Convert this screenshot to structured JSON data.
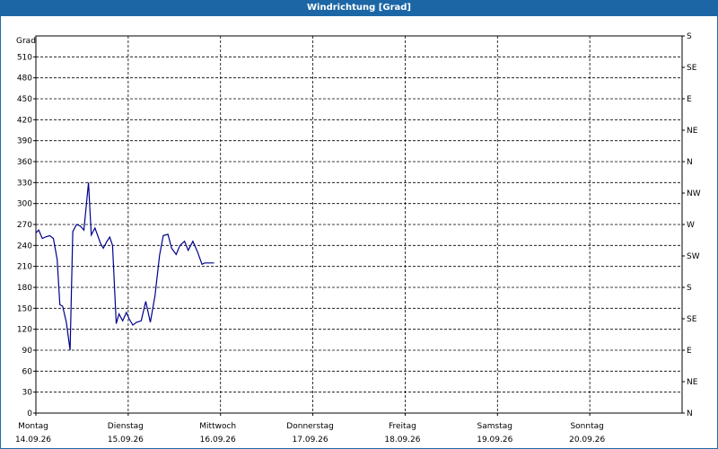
{
  "window": {
    "title": "Windrichtung [Grad]"
  },
  "chart_data": {
    "type": "line",
    "title": "Windrichtung [Grad]",
    "ylabel": "Grad",
    "ylim": [
      0,
      540
    ],
    "yticks": [
      0,
      30,
      60,
      90,
      120,
      150,
      180,
      210,
      240,
      270,
      300,
      330,
      360,
      390,
      420,
      450,
      480,
      510
    ],
    "right_axis_labels": [
      "N",
      "NE",
      "E",
      "SE",
      "S",
      "SW",
      "W",
      "NW",
      "N",
      "NE",
      "E",
      "SE",
      "S"
    ],
    "right_axis_values": [
      0,
      45,
      90,
      135,
      180,
      225,
      270,
      315,
      360,
      405,
      450,
      495,
      540
    ],
    "xlim": [
      0,
      7
    ],
    "x_categories": [
      {
        "day": "Montag",
        "date": "14.09.26"
      },
      {
        "day": "Dienstag",
        "date": "15.09.26"
      },
      {
        "day": "Mittwoch",
        "date": "16.09.26"
      },
      {
        "day": "Donnerstag",
        "date": "17.09.26"
      },
      {
        "day": "Freitag",
        "date": "18.09.26"
      },
      {
        "day": "Samstag",
        "date": "19.09.26"
      },
      {
        "day": "Sonntag",
        "date": "20.09.26"
      }
    ],
    "grid": true,
    "line_color": "#00008b",
    "series": [
      {
        "x": [
          0.0,
          0.03,
          0.07,
          0.1,
          0.15,
          0.19,
          0.23,
          0.26,
          0.29,
          0.33,
          0.37,
          0.4,
          0.44,
          0.48,
          0.52,
          0.57,
          0.6,
          0.64,
          0.7,
          0.73,
          0.77,
          0.8,
          0.83,
          0.87,
          0.9,
          0.94,
          0.96,
          0.98,
          1.01,
          1.05,
          1.09,
          1.14,
          1.19,
          1.24,
          1.29,
          1.34,
          1.38,
          1.43,
          1.47,
          1.52,
          1.56,
          1.61,
          1.65,
          1.7,
          1.75,
          1.8,
          1.83,
          1.87,
          1.91,
          1.93
        ],
        "y": [
          258,
          262,
          250,
          252,
          254,
          250,
          220,
          155,
          153,
          130,
          90,
          260,
          270,
          268,
          262,
          330,
          255,
          265,
          243,
          236,
          246,
          252,
          240,
          128,
          142,
          132,
          138,
          144,
          135,
          126,
          130,
          132,
          160,
          130,
          168,
          226,
          254,
          256,
          236,
          227,
          240,
          246,
          233,
          246,
          231,
          213,
          215,
          215,
          215,
          215
        ]
      }
    ]
  }
}
